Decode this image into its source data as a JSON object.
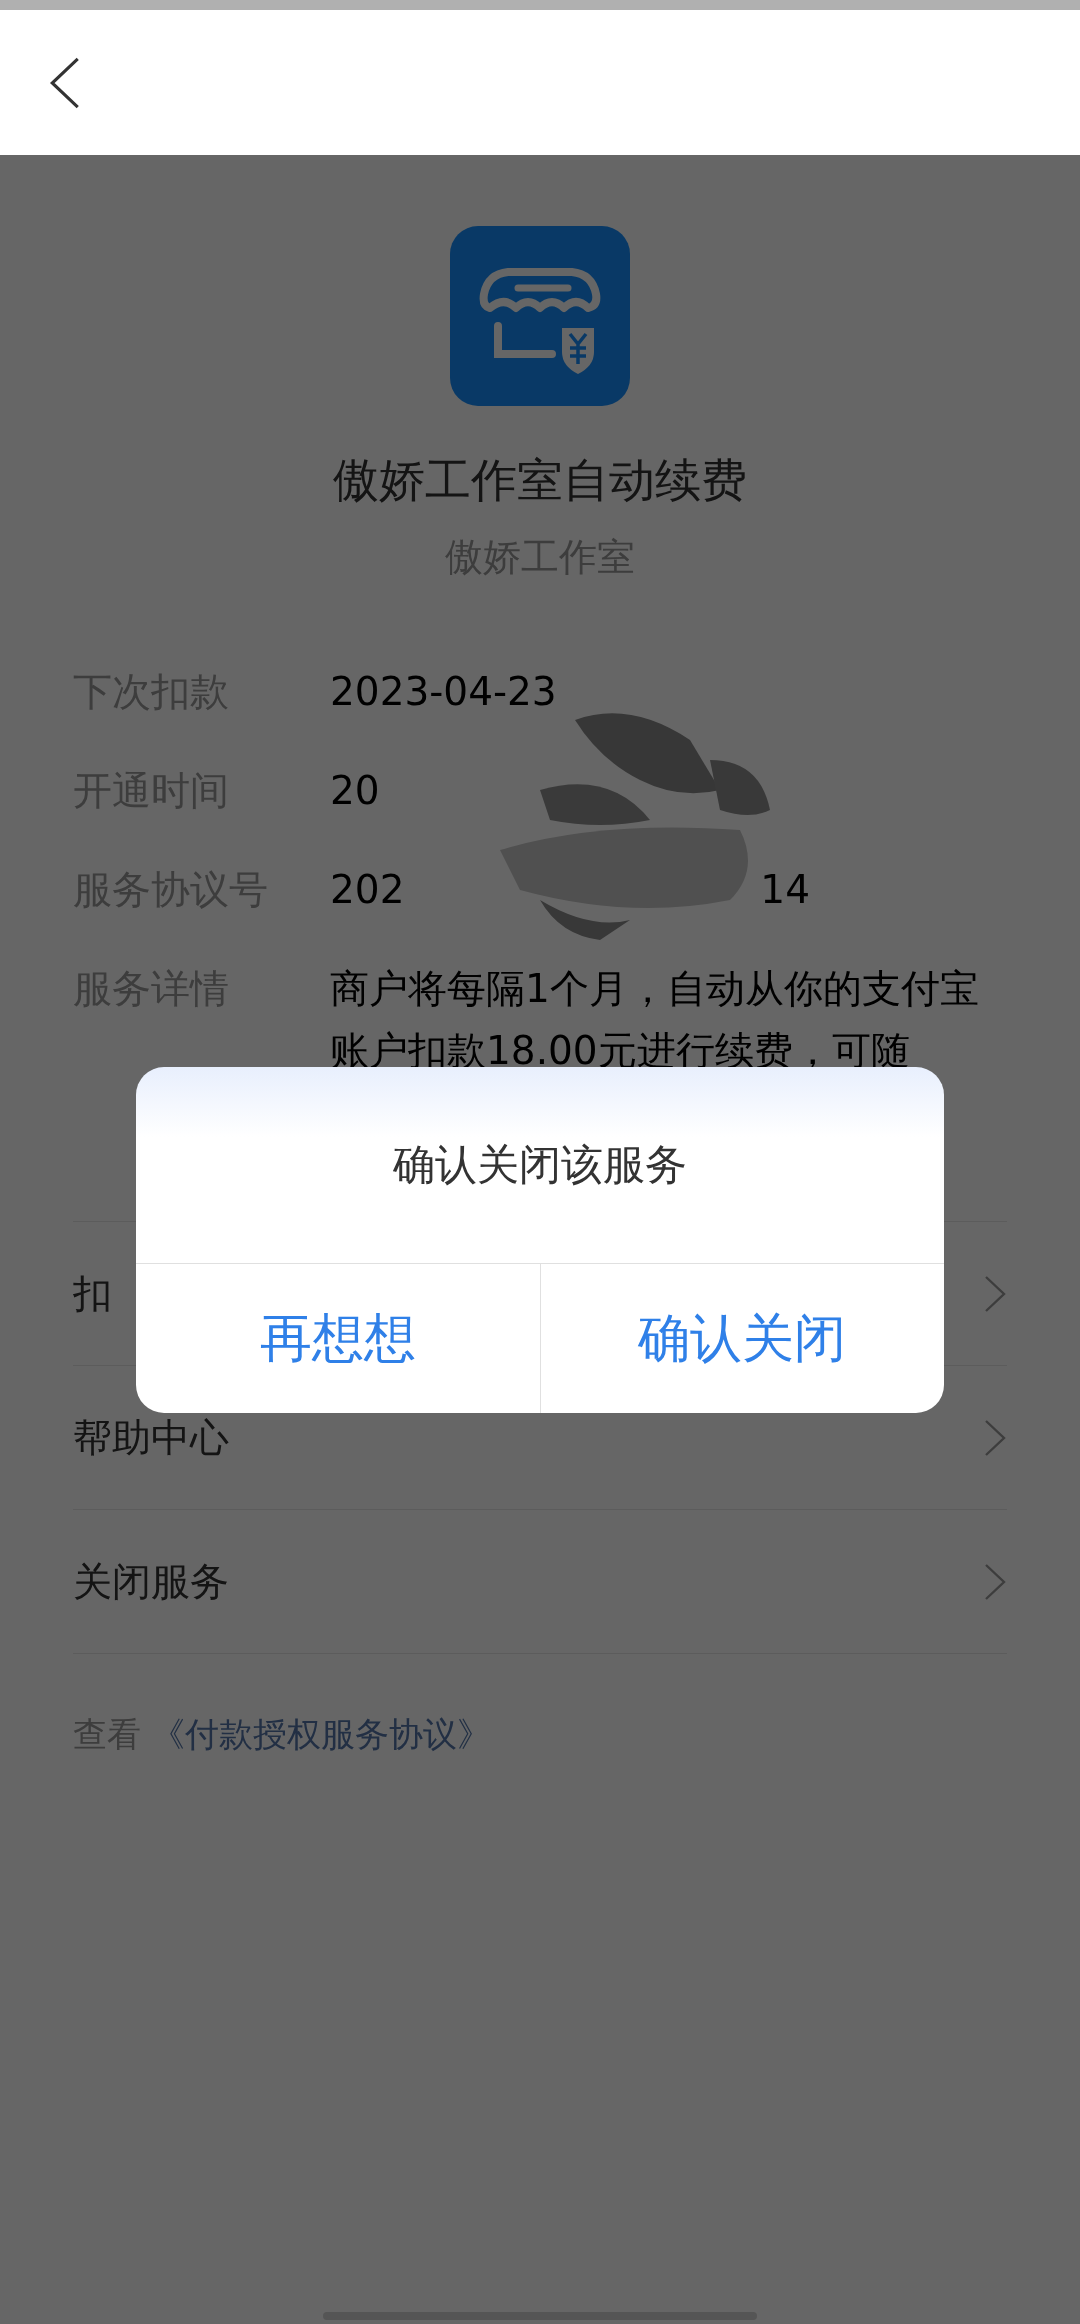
{
  "service": {
    "title": "傲娇工作室自动续费",
    "merchant": "傲娇工作室"
  },
  "info": [
    {
      "label": "下次扣款",
      "value": "2023-04-23"
    },
    {
      "label": "开通时间",
      "value": "20"
    },
    {
      "label": "服务协议号",
      "value": "202",
      "value_end": "14"
    },
    {
      "label": "服务详情",
      "value": "商户将每隔1个月，自动从你的支付宝账户扣款18.00元进行续费，可随"
    }
  ],
  "menu": [
    {
      "label": "扣"
    },
    {
      "label": "帮助中心"
    },
    {
      "label": "关闭服务"
    }
  ],
  "agreement": {
    "prefix": "查看",
    "link": "《付款授权服务协议》"
  },
  "dialog": {
    "message": "确认关闭该服务",
    "buttons": [
      "再想想",
      "确认关闭"
    ]
  }
}
